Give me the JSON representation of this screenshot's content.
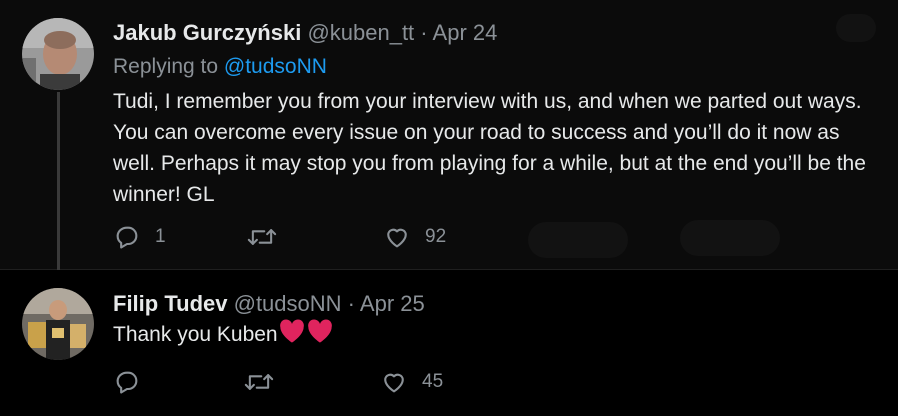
{
  "tweets": [
    {
      "author_name": "Jakub Gurczyński",
      "handle": "@kuben_tt",
      "separator": "·",
      "date": "Apr 24",
      "replying_prefix": "Replying to",
      "replying_to": "@tudsoNN",
      "text": "Tudi, I remember you from your interview with us, and when we parted out ways. You can overcome every issue on your road to success and you’ll do it now as well. Perhaps it may stop you from playing for a while, but at the end you’ll be the winner! GL",
      "replies": "1",
      "retweets": "",
      "likes": "92"
    },
    {
      "author_name": "Filip Tudev",
      "handle": "@tudsoNN",
      "separator": "·",
      "date": "Apr 25",
      "text": "Thank you Kuben",
      "emoji": [
        "red-heart",
        "red-heart"
      ],
      "replies": "",
      "retweets": "",
      "likes": "45"
    }
  ],
  "icons": {
    "reply": "speech-bubble-icon",
    "retweet": "retweet-arrows-icon",
    "like": "heart-outline-icon"
  },
  "colors": {
    "background": "#000000",
    "text": "#e7e9ea",
    "muted": "#8b9197",
    "link": "#1d9bf0",
    "heart": "#e0245e"
  }
}
